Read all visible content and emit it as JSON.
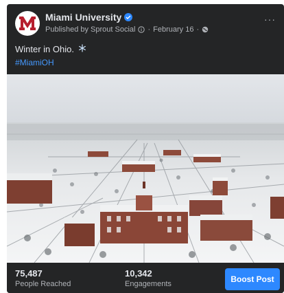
{
  "post": {
    "page_name": "Miami University",
    "avatar_logo": "miami-m-logo",
    "verified_icon": "verified-badge-icon",
    "published_by": "Published by Sprout Social",
    "date": "February 16",
    "separator": "·",
    "more_label": "···",
    "caption": "Winter in Ohio.",
    "caption_icon": "snowflake-icon",
    "hashtag": "#MiamiOH",
    "photo": "aerial-snowy-campus-photo"
  },
  "insights": {
    "reach_value": "75,487",
    "reach_label": "People Reached",
    "engagement_value": "10,342",
    "engagement_label": "Engagements",
    "boost_label": "Boost Post"
  },
  "colors": {
    "card_bg": "#242526",
    "accent": "#2d88ff",
    "hashtag": "#4599ff",
    "logo_red": "#b61e2e"
  }
}
